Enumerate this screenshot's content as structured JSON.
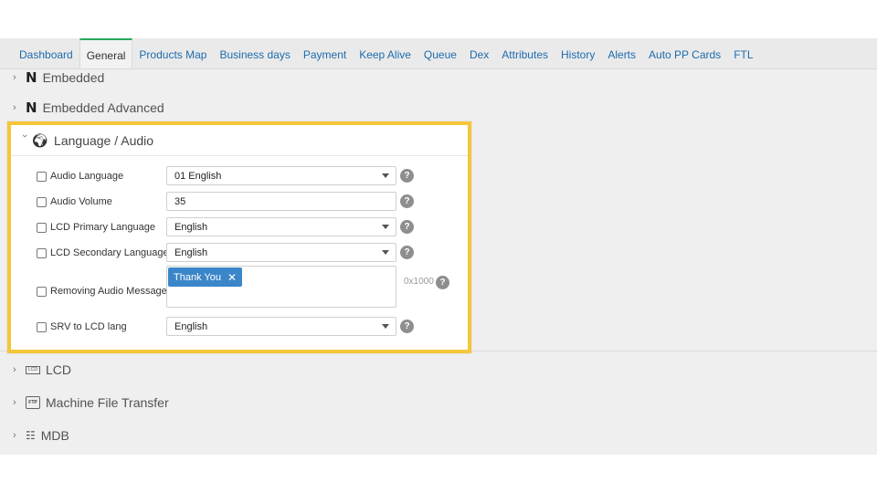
{
  "tabs": [
    {
      "label": "Dashboard",
      "active": false
    },
    {
      "label": "General",
      "active": true
    },
    {
      "label": "Products Map",
      "active": false
    },
    {
      "label": "Business days",
      "active": false
    },
    {
      "label": "Payment",
      "active": false
    },
    {
      "label": "Keep Alive",
      "active": false
    },
    {
      "label": "Queue",
      "active": false
    },
    {
      "label": "Dex",
      "active": false
    },
    {
      "label": "Attributes",
      "active": false
    },
    {
      "label": "History",
      "active": false
    },
    {
      "label": "Alerts",
      "active": false
    },
    {
      "label": "Auto PP Cards",
      "active": false
    },
    {
      "label": "FTL",
      "active": false
    }
  ],
  "sections": {
    "embedded": {
      "label": "Embedded",
      "icon": "nayax-n-icon"
    },
    "embedded_advanced": {
      "label": "Embedded Advanced",
      "icon": "nayax-n-icon"
    },
    "language_audio": {
      "label": "Language / Audio",
      "icon": "globe-icon",
      "expanded": true
    },
    "lcd": {
      "label": "LCD",
      "icon": "lcd-icon",
      "icon_text": "LCD"
    },
    "machine_file_transfer": {
      "label": "Machine File Transfer",
      "icon": "ftp-icon",
      "icon_text": "FTP"
    },
    "mdb": {
      "label": "MDB",
      "icon": "mdb-icon"
    }
  },
  "language_audio": {
    "audio_language": {
      "label": "Audio Language",
      "value": "01 English"
    },
    "audio_volume": {
      "label": "Audio Volume",
      "value": "35"
    },
    "lcd_primary_language": {
      "label": "LCD Primary Language",
      "value": "English"
    },
    "lcd_secondary_language": {
      "label": "LCD Secondary Language",
      "value": "English"
    },
    "removing_audio_message": {
      "label": "Removing Audio Message",
      "tag": "Thank You",
      "tag_remove": "✕",
      "hint": "0x1000"
    },
    "srv_to_lcd_lang": {
      "label": "SRV to LCD lang",
      "value": "English"
    }
  },
  "help_glyph": "?",
  "colors": {
    "highlight": "#f5c638",
    "tab_link": "#1f6fb2",
    "active_tab": "#27ae60",
    "tag": "#3a86c8"
  }
}
